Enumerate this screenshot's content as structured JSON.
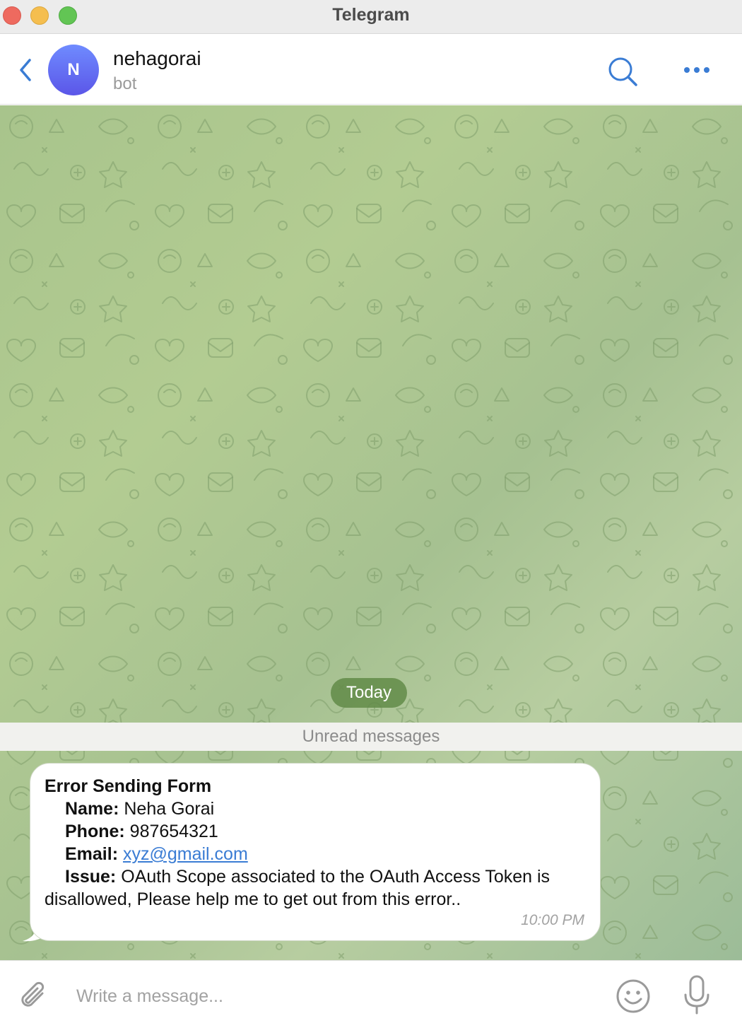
{
  "window": {
    "title": "Telegram"
  },
  "header": {
    "avatar_initial": "N",
    "peer_name": "nehagorai",
    "peer_status": "bot",
    "icons": {
      "back": "chevron-left-icon",
      "search": "search-icon",
      "more": "more-dots-icon"
    }
  },
  "chat": {
    "date_separator": "Today",
    "unread_label": "Unread messages",
    "message": {
      "title": "Error Sending Form",
      "name_label": "Name:",
      "name_value": "Neha Gorai",
      "phone_label": "Phone:",
      "phone_value": "987654321",
      "email_label": "Email:",
      "email_value": "xyz@gmail.com",
      "issue_label": "Issue:",
      "issue_value": "OAuth Scope associated to the OAuth Access Token is disallowed, Please help me to get out from this error..",
      "time": "10:00 PM"
    }
  },
  "composer": {
    "placeholder": "Write a message...",
    "icons": {
      "attach": "paperclip-icon",
      "emoji": "emoji-icon",
      "voice": "microphone-icon"
    }
  },
  "colors": {
    "accent": "#3a7cd4",
    "avatar_gradient_top": "#6f8bff",
    "avatar_gradient_bottom": "#5b56e8",
    "date_pill": "#628b48",
    "chat_background": "#a8c48c"
  }
}
